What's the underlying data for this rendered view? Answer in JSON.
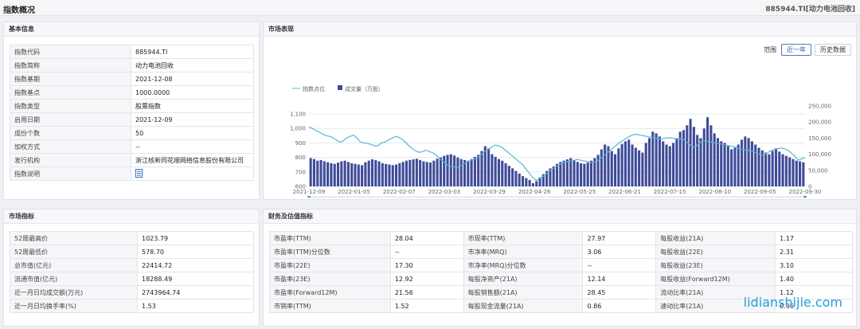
{
  "page": {
    "title": "指数概况",
    "code_label": "885944.TI[动力电池回收]"
  },
  "basic": {
    "heading": "基本信息",
    "rows": [
      {
        "k": "指数代码",
        "v": "885944.TI"
      },
      {
        "k": "指数简称",
        "v": "动力电池回收"
      },
      {
        "k": "指数基期",
        "v": "2021-12-08"
      },
      {
        "k": "指数基点",
        "v": "1000.0000"
      },
      {
        "k": "指数类型",
        "v": "股票指数"
      },
      {
        "k": "启用日期",
        "v": "2021-12-09"
      },
      {
        "k": "成份个数",
        "v": "50"
      },
      {
        "k": "加权方式",
        "v": "--"
      },
      {
        "k": "发行机构",
        "v": "浙江核新同花顺网络信息股份有限公司"
      },
      {
        "k": "指数说明",
        "v": ""
      }
    ]
  },
  "market": {
    "heading": "市场表现",
    "range_label": "范围",
    "btn_1y": "近一年",
    "btn_hist": "历史数据"
  },
  "chart_data": {
    "type": "bar+line",
    "legend": [
      "指数点位",
      "成交量（万股）"
    ],
    "x_ticks": [
      "2021-12-09",
      "2022-01-05",
      "2022-02-07",
      "2022-03-03",
      "2022-03-29",
      "2022-04-26",
      "2022-05-25",
      "2022-06-21",
      "2022-07-15",
      "2022-08-10",
      "2022-09-05",
      "2022-09-30"
    ],
    "y_left_ticks": [
      "600",
      "700",
      "800",
      "900",
      "1,000",
      "1,100"
    ],
    "y_right_ticks": [
      "0",
      "50,000",
      "100,000",
      "150,000",
      "200,000",
      "250,000"
    ],
    "y_left_range": [
      600,
      1100
    ],
    "y_right_range": [
      0,
      250000
    ],
    "series": [
      {
        "name": "指数点位",
        "kind": "line",
        "color": "#5ab4d6",
        "values": [
          1010,
          1000,
          985,
          975,
          960,
          950,
          945,
          935,
          920,
          905,
          915,
          935,
          945,
          955,
          930,
          905,
          900,
          895,
          890,
          880,
          880,
          900,
          905,
          920,
          930,
          945,
          940,
          925,
          905,
          880,
          860,
          845,
          835,
          840,
          850,
          840,
          830,
          815,
          790,
          770,
          750,
          740,
          735,
          730,
          740,
          755,
          770,
          780,
          790,
          800,
          820,
          840,
          855,
          870,
          885,
          880,
          870,
          850,
          830,
          810,
          790,
          770,
          750,
          720,
          690,
          660,
          640,
          655,
          670,
          690,
          710,
          725,
          740,
          755,
          765,
          770,
          775,
          780,
          785,
          780,
          775,
          770,
          765,
          770,
          780,
          800,
          820,
          840,
          860,
          880,
          900,
          915,
          930,
          945,
          955,
          960,
          955,
          950,
          945,
          940,
          935,
          930,
          925,
          930,
          935,
          935,
          930,
          925,
          930,
          920,
          900,
          880,
          870,
          890,
          910,
          915,
          910,
          905,
          900,
          895,
          890,
          885,
          880,
          875,
          870,
          860,
          855,
          850,
          845,
          840,
          830,
          820,
          810,
          830,
          845,
          855,
          860,
          865,
          860,
          850,
          830,
          810,
          780,
          790,
          800
        ]
      },
      {
        "name": "成交量（万股）",
        "kind": "bar",
        "color": "#3f4b98",
        "values": [
          88000,
          85000,
          80000,
          82000,
          78000,
          75000,
          72000,
          70000,
          74000,
          78000,
          80000,
          76000,
          72000,
          70000,
          68000,
          66000,
          75000,
          80000,
          84000,
          82000,
          78000,
          72000,
          70000,
          68000,
          66000,
          68000,
          72000,
          76000,
          80000,
          82000,
          84000,
          86000,
          82000,
          78000,
          76000,
          74000,
          80000,
          86000,
          90000,
          95000,
          98000,
          100000,
          96000,
          90000,
          85000,
          82000,
          80000,
          85000,
          92000,
          98000,
          110000,
          125000,
          118000,
          100000,
          92000,
          85000,
          80000,
          72000,
          64000,
          56000,
          48000,
          40000,
          32000,
          26000,
          20000,
          10000,
          16000,
          28000,
          38000,
          48000,
          56000,
          62000,
          70000,
          76000,
          80000,
          84000,
          88000,
          82000,
          76000,
          72000,
          70000,
          74000,
          80000,
          88000,
          98000,
          115000,
          130000,
          125000,
          110000,
          100000,
          118000,
          132000,
          140000,
          145000,
          130000,
          120000,
          112000,
          105000,
          135000,
          150000,
          170000,
          165000,
          155000,
          140000,
          130000,
          125000,
          135000,
          150000,
          170000,
          175000,
          190000,
          210000,
          185000,
          160000,
          150000,
          180000,
          215000,
          190000,
          165000,
          150000,
          140000,
          135000,
          125000,
          115000,
          120000,
          130000,
          145000,
          155000,
          150000,
          140000,
          130000,
          120000,
          112000,
          105000,
          100000,
          110000,
          118000,
          108000,
          100000,
          95000,
          90000,
          85000,
          80000,
          78000,
          75000
        ]
      }
    ]
  },
  "indicators": {
    "heading": "市场指标",
    "rows": [
      {
        "k": "52周最高价",
        "v": "1023.79"
      },
      {
        "k": "52周最低价",
        "v": "578.70"
      },
      {
        "k": "总市值(亿元)",
        "v": "22414.72"
      },
      {
        "k": "流通市值(亿元)",
        "v": "18288.49"
      },
      {
        "k": "近一月日均成交额(万元)",
        "v": "2743964.74"
      },
      {
        "k": "近一月日均换手率(%)",
        "v": "1.53"
      }
    ]
  },
  "finance": {
    "heading": "财务及估值指标",
    "rows": [
      [
        "市盈率(TTM)",
        "28.04",
        "市现率(TTM)",
        "27.97",
        "每股收益(21A)",
        "1.17"
      ],
      [
        "市盈率(TTM)分位数",
        "--",
        "市净率(MRQ)",
        "3.06",
        "每股收益(22E)",
        "2.31"
      ],
      [
        "市盈率(22E)",
        "17.30",
        "市净率(MRQ)分位数",
        "--",
        "每股收益(23E)",
        "3.10"
      ],
      [
        "市盈率(23E)",
        "12.92",
        "每股净资产(21A)",
        "12.14",
        "每股收益(Forward12M)",
        "1.40"
      ],
      [
        "市盈率(Forward12M)",
        "21.56",
        "每股销售额(21A)",
        "28.45",
        "流动比率(21A)",
        "1.12"
      ],
      [
        "市销率(TTM)",
        "1.52",
        "每股现金流量(21A)",
        "0.86",
        "速动比率(21A)",
        "0.96"
      ]
    ]
  },
  "watermark": "lidianshijie.com"
}
